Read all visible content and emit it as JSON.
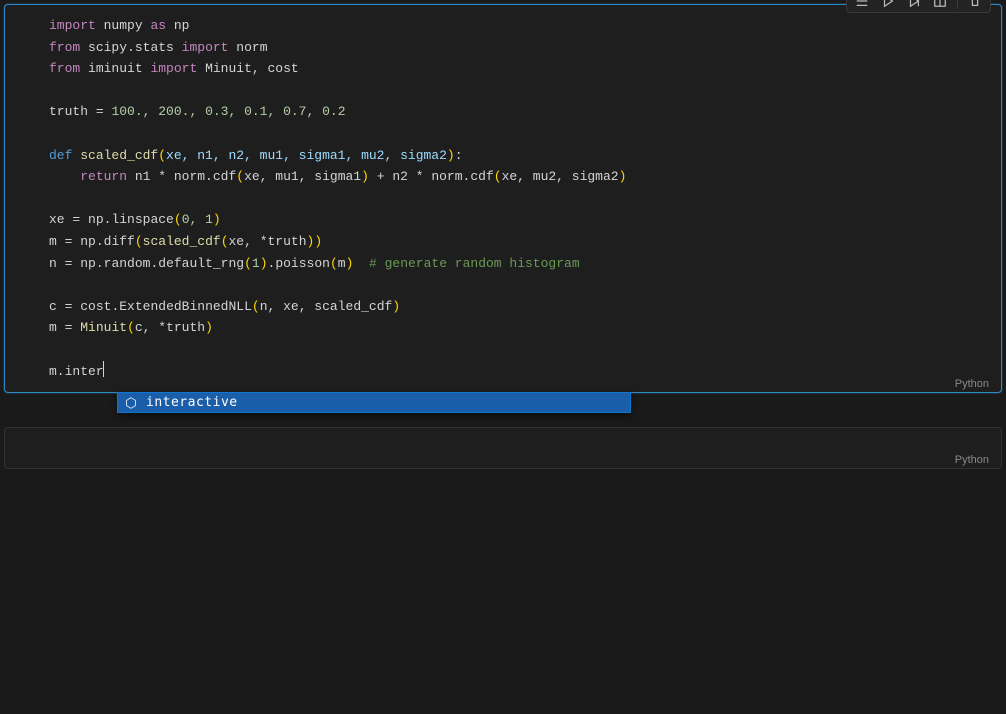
{
  "language_tag": "Python",
  "code": {
    "l1": {
      "import": "import",
      "numpy": "numpy",
      "as": "as",
      "np": "np"
    },
    "l2": {
      "from": "from",
      "mod": "scipy.stats",
      "import": "import",
      "name": "norm"
    },
    "l3": {
      "from": "from",
      "mod": "iminuit",
      "import": "import",
      "names": "Minuit, cost"
    },
    "l5": {
      "lhs": "truth",
      "eq": "=",
      "vals": "100., 200., 0.3, 0.1, 0.7, 0.2"
    },
    "l7": {
      "def": "def",
      "fn": "scaled_cdf",
      "params": "xe, n1, n2, mu1, sigma1, mu2, sigma2"
    },
    "l8": {
      "return": "return",
      "expr_a": "n1 * norm.cdf",
      "args_a": "xe, mu1, sigma1",
      "plus": " + ",
      "expr_b": "n2 * norm.cdf",
      "args_b": "xe, mu2, sigma2"
    },
    "l10": {
      "lhs": "xe",
      "eq": "=",
      "call": "np.linspace",
      "args": "0, 1"
    },
    "l11": {
      "lhs": "m",
      "eq": "=",
      "call": "np.diff",
      "inner": "scaled_cdf",
      "args": "xe, *truth"
    },
    "l12": {
      "lhs": "n",
      "eq": "=",
      "call": "np.random.default_rng",
      "arg1": "1",
      "tail": ".poisson",
      "arg2": "m",
      "comment": "# generate random histogram"
    },
    "l14": {
      "lhs": "c",
      "eq": "=",
      "call": "cost.ExtendedBinnedNLL",
      "args": "n, xe, scaled_cdf"
    },
    "l15": {
      "lhs": "m",
      "eq": "=",
      "call": "Minuit",
      "args": "c, *truth"
    },
    "l17": {
      "expr": "m.inter"
    }
  },
  "autocomplete": {
    "item": "interactive"
  }
}
